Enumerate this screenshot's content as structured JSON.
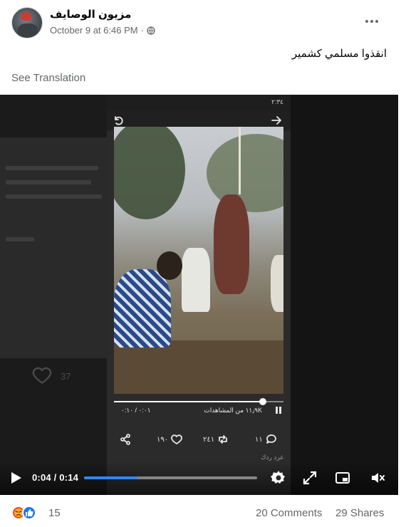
{
  "post": {
    "author": "مزيون الوصايف",
    "timestamp": "October 9 at 6:46 PM",
    "separator": "·",
    "privacy_icon": "globe-icon",
    "more_icon": "more-options-icon",
    "text": "انقذوا مسلمي كشمير",
    "see_translation": "See Translation"
  },
  "video": {
    "current_time": "0:04",
    "duration": "0:14",
    "time_display": "0:04 / 0:14",
    "progress": 0.31,
    "icons": [
      "play-icon",
      "settings-icon",
      "fullscreen-icon",
      "picture-in-picture-icon",
      "mute-icon"
    ],
    "accent_color": "#2d88ff"
  },
  "embedded_phone": {
    "status_time": "٢:٣٤",
    "views_text": "١١٫٩K من المشاهدات",
    "time_text": "٠:٠١ / ٠:١٠",
    "seek_progress": 0.88,
    "likes": "١٩٠",
    "reposts": "٢٤١",
    "replies": "١١",
    "caption": "غرد ردك"
  },
  "background_like_count": "37",
  "footer": {
    "reactions": [
      "angry-reaction-icon",
      "like-reaction-icon"
    ],
    "reaction_count": "15",
    "comments": "20 Comments",
    "shares": "29 Shares"
  }
}
